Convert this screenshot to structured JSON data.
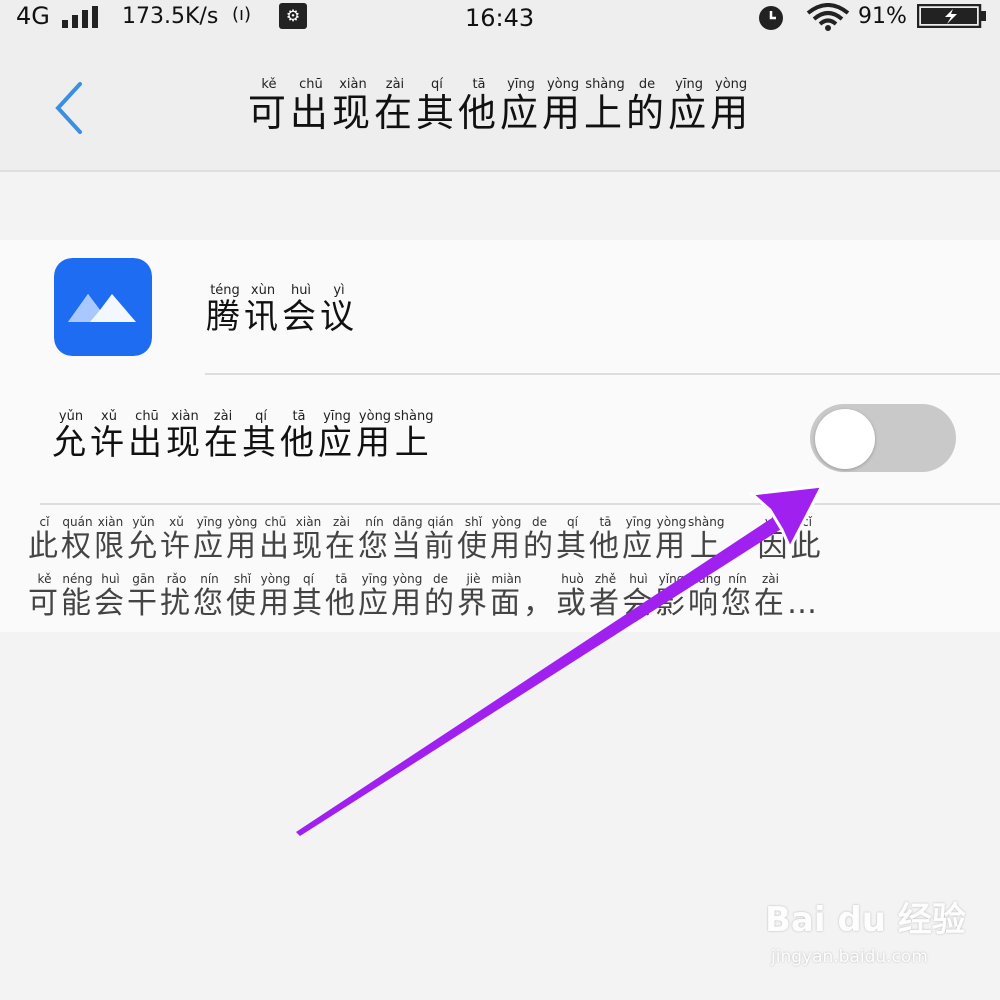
{
  "status_bar": {
    "network": "4G",
    "speed": "173.5K/s",
    "hotspot": "(ı)",
    "time": "16:43",
    "battery_percent": "91%"
  },
  "header": {
    "title_chars": [
      {
        "c": "可",
        "p": "kě"
      },
      {
        "c": "出",
        "p": "chū"
      },
      {
        "c": "现",
        "p": "xiàn"
      },
      {
        "c": "在",
        "p": "zài"
      },
      {
        "c": "其",
        "p": "qí"
      },
      {
        "c": "他",
        "p": "tā"
      },
      {
        "c": "应",
        "p": "yīng"
      },
      {
        "c": "用",
        "p": "yòng"
      },
      {
        "c": "上",
        "p": "shàng"
      },
      {
        "c": "的",
        "p": "de"
      },
      {
        "c": "应",
        "p": "yīng"
      },
      {
        "c": "用",
        "p": "yòng"
      }
    ]
  },
  "app": {
    "name_chars": [
      {
        "c": "腾",
        "p": "téng"
      },
      {
        "c": "讯",
        "p": "xùn"
      },
      {
        "c": "会",
        "p": "huì"
      },
      {
        "c": "议",
        "p": "yì"
      }
    ],
    "brand_color": "#1b66f0"
  },
  "permission": {
    "label_chars": [
      {
        "c": "允",
        "p": "yǔn"
      },
      {
        "c": "许",
        "p": "xǔ"
      },
      {
        "c": "出",
        "p": "chū"
      },
      {
        "c": "现",
        "p": "xiàn"
      },
      {
        "c": "在",
        "p": "zài"
      },
      {
        "c": "其",
        "p": "qí"
      },
      {
        "c": "他",
        "p": "tā"
      },
      {
        "c": "应",
        "p": "yīng"
      },
      {
        "c": "用",
        "p": "yòng"
      },
      {
        "c": "上",
        "p": "shàng"
      }
    ],
    "enabled": false
  },
  "description": {
    "line1": [
      {
        "c": "此",
        "p": "cǐ"
      },
      {
        "c": "权",
        "p": "quán"
      },
      {
        "c": "限",
        "p": "xiàn"
      },
      {
        "c": "允",
        "p": "yǔn"
      },
      {
        "c": "许",
        "p": "xǔ"
      },
      {
        "c": "应",
        "p": "yīng"
      },
      {
        "c": "用",
        "p": "yòng"
      },
      {
        "c": "出",
        "p": "chū"
      },
      {
        "c": "现",
        "p": "xiàn"
      },
      {
        "c": "在",
        "p": "zài"
      },
      {
        "c": "您",
        "p": "nín"
      },
      {
        "c": "当",
        "p": "dāng"
      },
      {
        "c": "前",
        "p": "qián"
      },
      {
        "c": "使",
        "p": "shǐ"
      },
      {
        "c": "用",
        "p": "yòng"
      },
      {
        "c": "的",
        "p": "de"
      },
      {
        "c": "其",
        "p": "qí"
      },
      {
        "c": "他",
        "p": "tā"
      },
      {
        "c": "应",
        "p": "yīng"
      },
      {
        "c": "用",
        "p": "yòng"
      },
      {
        "c": "上",
        "p": "shàng"
      },
      {
        "c": "，",
        "p": ""
      },
      {
        "c": "因",
        "p": "yīn"
      },
      {
        "c": "此",
        "p": "cǐ"
      }
    ],
    "line2": [
      {
        "c": "可",
        "p": "kě"
      },
      {
        "c": "能",
        "p": "néng"
      },
      {
        "c": "会",
        "p": "huì"
      },
      {
        "c": "干",
        "p": "gān"
      },
      {
        "c": "扰",
        "p": "rǎo"
      },
      {
        "c": "您",
        "p": "nín"
      },
      {
        "c": "使",
        "p": "shǐ"
      },
      {
        "c": "用",
        "p": "yòng"
      },
      {
        "c": "其",
        "p": "qí"
      },
      {
        "c": "他",
        "p": "tā"
      },
      {
        "c": "应",
        "p": "yīng"
      },
      {
        "c": "用",
        "p": "yòng"
      },
      {
        "c": "的",
        "p": "de"
      },
      {
        "c": "界",
        "p": "jiè"
      },
      {
        "c": "面",
        "p": "miàn"
      },
      {
        "c": "，",
        "p": ""
      },
      {
        "c": "或",
        "p": "huò"
      },
      {
        "c": "者",
        "p": "zhě"
      },
      {
        "c": "会",
        "p": "huì"
      },
      {
        "c": "影",
        "p": "yǐng"
      },
      {
        "c": "响",
        "p": "xiǎng"
      },
      {
        "c": "您",
        "p": "nín"
      },
      {
        "c": "在",
        "p": "zài"
      },
      {
        "c": "…",
        "p": ""
      }
    ]
  },
  "annotation": {
    "arrow_color": "#a020f0"
  },
  "watermark": {
    "logo": "Bai du 经验",
    "site": "jingyan.baidu.com"
  }
}
